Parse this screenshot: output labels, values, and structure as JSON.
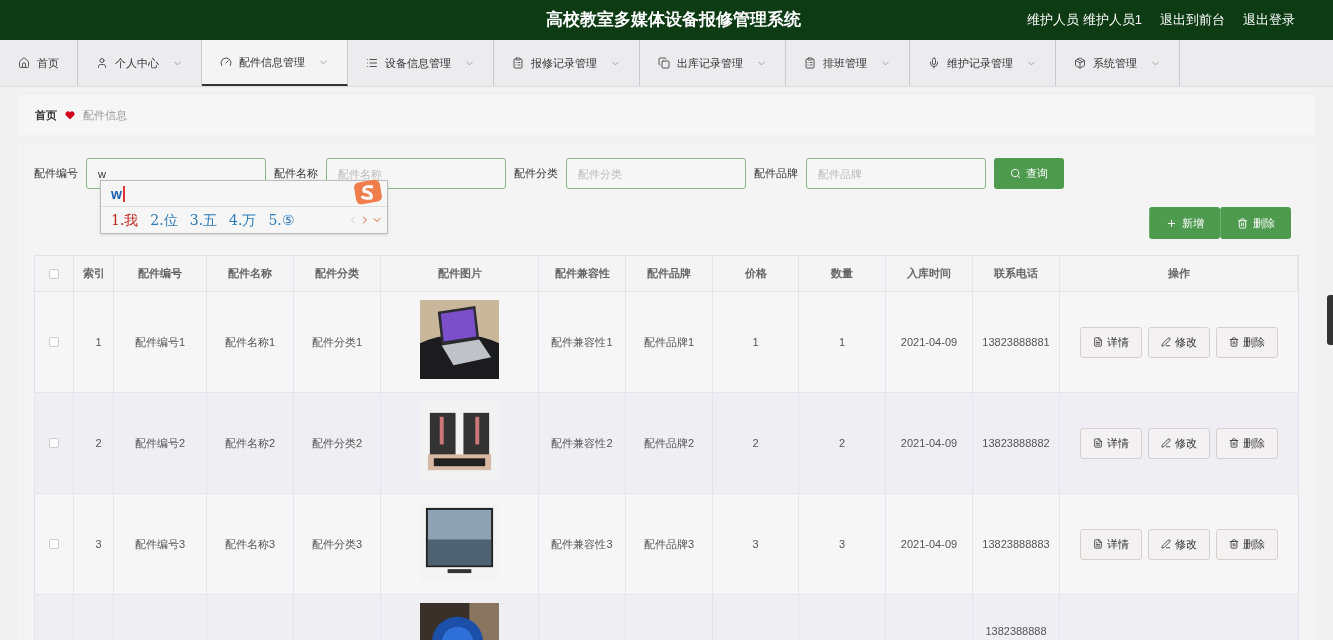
{
  "header": {
    "title": "高校教室多媒体设备报修管理系统",
    "user": "维护人员 维护人员1",
    "links": [
      "退出到前台",
      "退出登录"
    ]
  },
  "nav": [
    {
      "label": "首页",
      "dropdown": false,
      "selected": false
    },
    {
      "label": "个人中心",
      "dropdown": true,
      "selected": false
    },
    {
      "label": "配件信息管理",
      "dropdown": true,
      "selected": true
    },
    {
      "label": "设备信息管理",
      "dropdown": true,
      "selected": false
    },
    {
      "label": "报修记录管理",
      "dropdown": true,
      "selected": false
    },
    {
      "label": "出库记录管理",
      "dropdown": true,
      "selected": false
    },
    {
      "label": "排班管理",
      "dropdown": true,
      "selected": false
    },
    {
      "label": "维护记录管理",
      "dropdown": true,
      "selected": false
    },
    {
      "label": "系统管理",
      "dropdown": true,
      "selected": false
    }
  ],
  "breadcrumb": [
    "首页",
    "配件信息"
  ],
  "search": {
    "fields": [
      {
        "label": "配件编号",
        "value": "w"
      },
      {
        "label": "配件名称",
        "placeholder": "配件名称"
      },
      {
        "label": "配件分类",
        "placeholder": "配件分类"
      },
      {
        "label": "配件品牌",
        "placeholder": "配件品牌"
      }
    ],
    "button": "查询"
  },
  "ime": {
    "composition": "w",
    "candidates": [
      {
        "text": "1.我",
        "selected": true
      },
      {
        "text": "2.位",
        "selected": false
      },
      {
        "text": "3.五",
        "selected": false
      },
      {
        "text": "4.万",
        "selected": false
      },
      {
        "text": "5.⑤",
        "selected": false
      }
    ]
  },
  "actions": [
    "新增",
    "删除"
  ],
  "table": {
    "select_all_checked": false,
    "columns": [
      "索引",
      "配件编号",
      "配件名称",
      "配件分类",
      "配件图片",
      "配件兼容性",
      "配件品牌",
      "价格",
      "数量",
      "入库时间",
      "联系电话",
      "操作"
    ],
    "rows": [
      {
        "cells": [
          "1",
          "配件编号1",
          "配件名称1",
          "配件分类1",
          null,
          "配件兼容性1",
          "配件品牌1",
          "1",
          "1",
          "2021-04-09",
          "13823888881"
        ],
        "checked": false,
        "buttons": [
          "详情",
          "修改",
          "删除"
        ]
      },
      {
        "cells": [
          "2",
          "配件编号2",
          "配件名称2",
          "配件分类2",
          null,
          "配件兼容性2",
          "配件品牌2",
          "2",
          "2",
          "2021-04-09",
          "13823888882"
        ],
        "checked": false,
        "buttons": [
          "详情",
          "修改",
          "删除"
        ]
      },
      {
        "cells": [
          "3",
          "配件编号3",
          "配件名称3",
          "配件分类3",
          null,
          "配件兼容性3",
          "配件品牌3",
          "3",
          "3",
          "2021-04-09",
          "13823888883"
        ],
        "checked": false,
        "buttons": [
          "详情",
          "修改",
          "删除"
        ]
      },
      {
        "cells": [
          null,
          null,
          null,
          null,
          null,
          null,
          null,
          null,
          null,
          null,
          "1382388888"
        ]
      }
    ]
  }
}
